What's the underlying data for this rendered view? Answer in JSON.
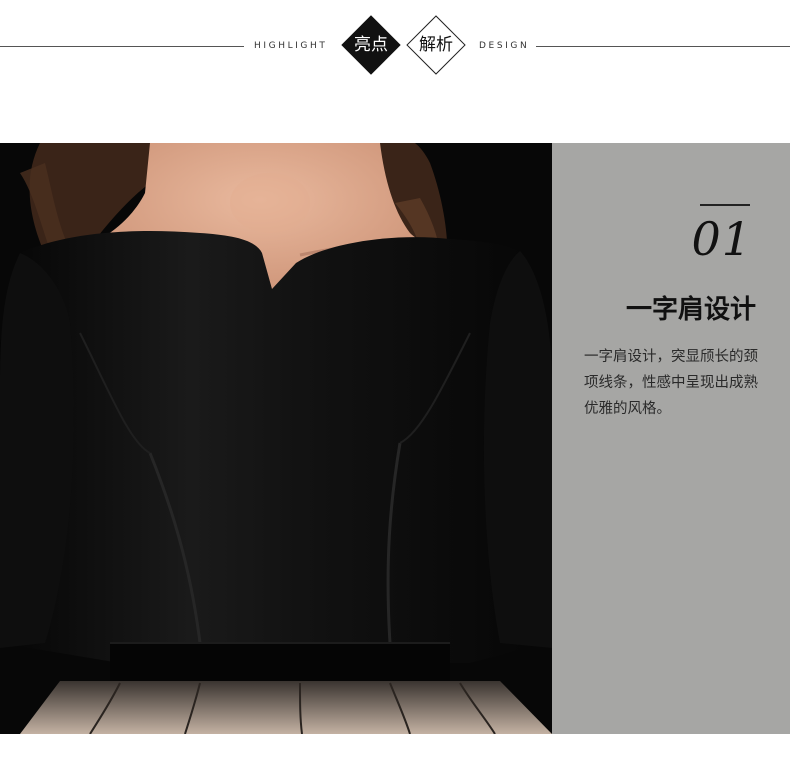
{
  "header": {
    "left_text": "HIGHLIGHT",
    "right_text": "DESIGN",
    "badge_filled": "亮点",
    "badge_outline": "解析"
  },
  "photo": {
    "subject": "black-velvet-dress-photo"
  },
  "feature": {
    "number": "01",
    "title": "一字肩设计",
    "description": "一字肩设计，突显颀长的颈项线条，性感中呈现出成熟优雅的风格。"
  },
  "colors": {
    "panel_bg": "#a6a6a4",
    "dress": "#0b0b0b",
    "skin": "#d9a58a",
    "hair": "#3a2418",
    "tulle": "#b9a79a"
  }
}
